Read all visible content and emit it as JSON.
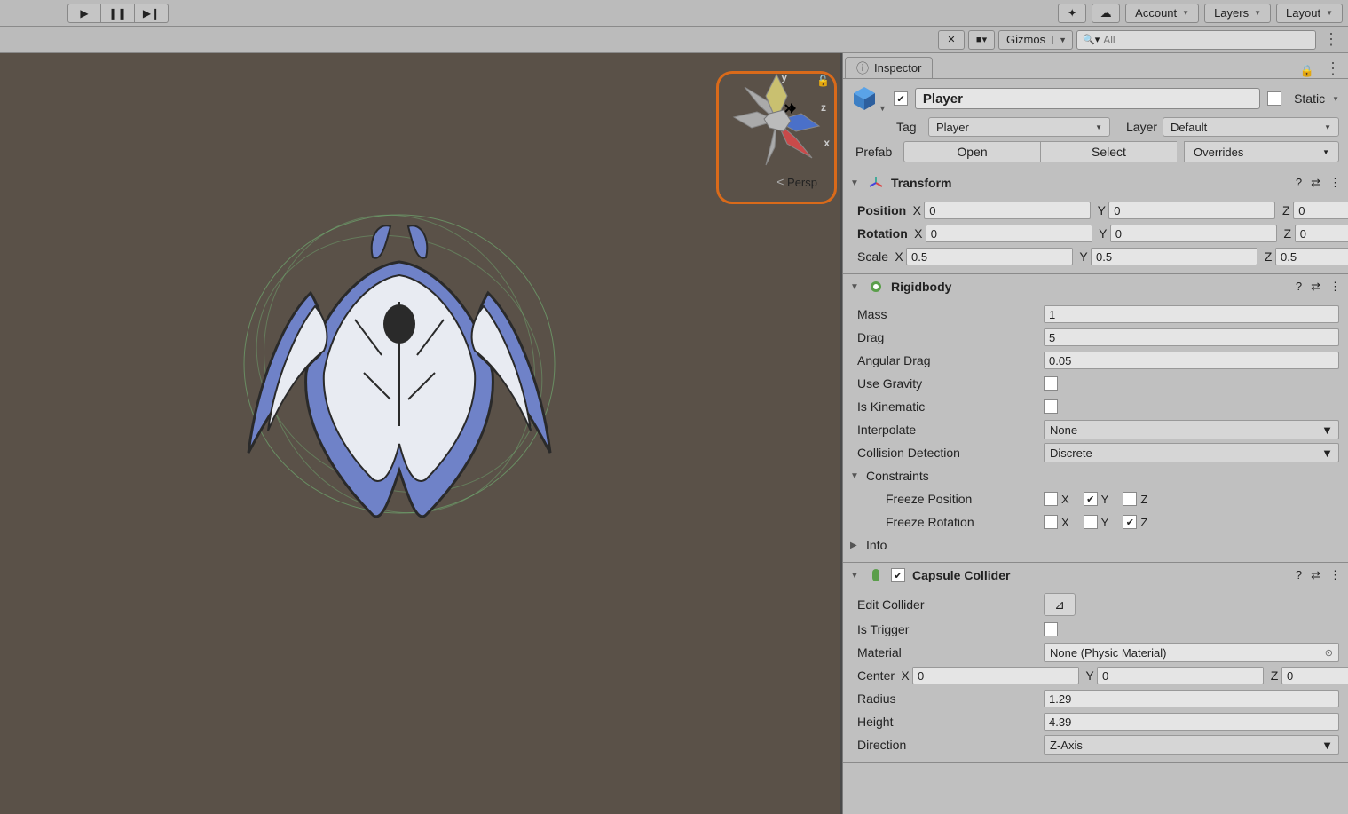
{
  "toolbar": {
    "account": "Account",
    "layers": "Layers",
    "layout": "Layout"
  },
  "scenebar": {
    "gizmos": "Gizmos",
    "search_placeholder": "All"
  },
  "gizmo": {
    "x": "x",
    "y": "y",
    "z": "z",
    "persp": "Persp"
  },
  "inspector": {
    "tab": "Inspector",
    "object_name": "Player",
    "static": "Static",
    "tag_label": "Tag",
    "tag_value": "Player",
    "layer_label": "Layer",
    "layer_value": "Default",
    "prefab_label": "Prefab",
    "prefab_open": "Open",
    "prefab_select": "Select",
    "prefab_overrides": "Overrides"
  },
  "transform": {
    "title": "Transform",
    "position": "Position",
    "rotation": "Rotation",
    "scale": "Scale",
    "pos_x": "0",
    "pos_y": "0",
    "pos_z": "0",
    "rot_x": "0",
    "rot_y": "0",
    "rot_z": "0",
    "scl_x": "0.5",
    "scl_y": "0.5",
    "scl_z": "0.5"
  },
  "rigidbody": {
    "title": "Rigidbody",
    "mass_label": "Mass",
    "mass": "1",
    "drag_label": "Drag",
    "drag": "5",
    "angdrag_label": "Angular Drag",
    "angdrag": "0.05",
    "usegrav_label": "Use Gravity",
    "iskin_label": "Is Kinematic",
    "interp_label": "Interpolate",
    "interp": "None",
    "coll_label": "Collision Detection",
    "coll": "Discrete",
    "constraints_label": "Constraints",
    "freezepos_label": "Freeze Position",
    "freezerot_label": "Freeze Rotation",
    "freezepos": {
      "x": false,
      "y": true,
      "z": false
    },
    "freezerot": {
      "x": false,
      "y": false,
      "z": true
    },
    "info_label": "Info"
  },
  "capsule": {
    "title": "Capsule Collider",
    "editcoll_label": "Edit Collider",
    "istrig_label": "Is Trigger",
    "material_label": "Material",
    "material": "None (Physic Material)",
    "center_label": "Center",
    "cx": "0",
    "cy": "0",
    "cz": "0",
    "radius_label": "Radius",
    "radius": "1.29",
    "height_label": "Height",
    "height": "4.39",
    "direction_label": "Direction",
    "direction": "Z-Axis"
  },
  "axis": {
    "x": "X",
    "y": "Y",
    "z": "Z"
  }
}
